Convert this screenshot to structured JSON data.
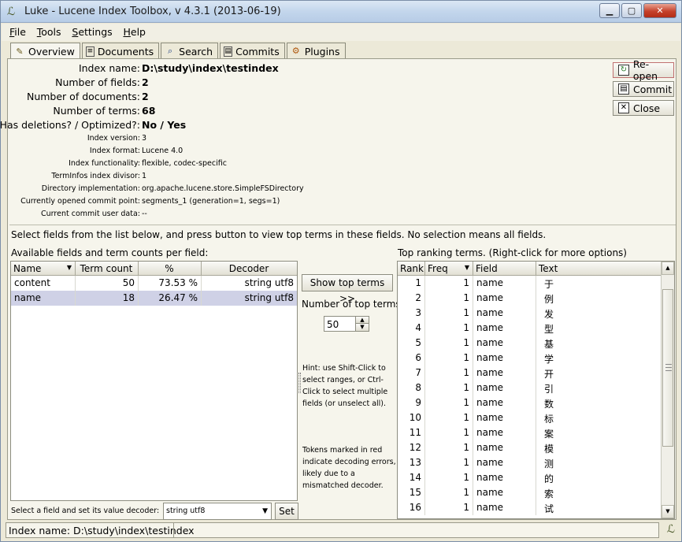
{
  "window": {
    "title": "Luke - Lucene Index Toolbox, v 4.3.1 (2013-06-19)",
    "icon": "luke-feather-icon"
  },
  "menu": [
    {
      "u": "F",
      "rest": "ile"
    },
    {
      "u": "T",
      "rest": "ools"
    },
    {
      "u": "S",
      "rest": "ettings"
    },
    {
      "u": "H",
      "rest": "elp"
    }
  ],
  "tabs": [
    {
      "label": "Overview",
      "icon": "overview-icon",
      "active": true
    },
    {
      "label": "Documents",
      "icon": "documents-icon",
      "active": false
    },
    {
      "label": "Search",
      "icon": "search-icon",
      "active": false
    },
    {
      "label": "Commits",
      "icon": "commits-icon",
      "active": false
    },
    {
      "label": "Plugins",
      "icon": "plugins-icon",
      "active": false
    }
  ],
  "overview": {
    "index_name_label": "Index name:",
    "index_name": "D:\\study\\index\\testindex",
    "num_fields_label": "Number of fields:",
    "num_fields": "2",
    "num_docs_label": "Number of documents:",
    "num_docs": "2",
    "num_terms_label": "Number of terms:",
    "num_terms": "68",
    "deletions_label": "Has deletions? / Optimized?:",
    "deletions": "No / Yes",
    "index_version_label": "Index version:",
    "index_version": "3",
    "index_format_label": "Index format:",
    "index_format": "Lucene 4.0",
    "functionality_label": "Index functionality:",
    "functionality": "flexible, codec-specific",
    "divisor_label": "TermInfos index divisor:",
    "divisor": "1",
    "dir_impl_label": "Directory implementation:",
    "dir_impl": "org.apache.lucene.store.SimpleFSDirectory",
    "commit_point_label": "Currently opened commit point:",
    "commit_point": "segments_1 (generation=1, segs=1)",
    "user_data_label": "Current commit user data:",
    "user_data": "--"
  },
  "buttons": {
    "reopen": "Re-open",
    "commit": "Commit",
    "close": "Close"
  },
  "instructions": "Select fields from the list below, and press button to view top terms in these fields. No selection means all fields.",
  "fields_table": {
    "label": "Available fields and term counts per field:",
    "headers": [
      "Name",
      "Term count",
      "%",
      "Decoder"
    ],
    "rows": [
      {
        "name": "content",
        "count": "50",
        "pct": "73.53 %",
        "decoder": "string utf8",
        "selected": false
      },
      {
        "name": "name",
        "count": "18",
        "pct": "26.47 %",
        "decoder": "string utf8",
        "selected": true
      }
    ]
  },
  "decoder": {
    "label": "Select a field and set its value decoder:",
    "value": "string utf8",
    "set_label": "Set"
  },
  "middle": {
    "show_top_label": "Show top terms >>",
    "num_top_label": "Number of top terms:",
    "num_top_value": "50",
    "hint": "Hint: use Shift-Click to select ranges, or Ctrl-Click to select multiple fields (or unselect all).",
    "tokens_note": "Tokens marked in red indicate decoding errors, likely due to a mismatched decoder."
  },
  "terms_table": {
    "label": "Top ranking terms. (Right-click for more options)",
    "headers": [
      "Rank",
      "Freq",
      "Field",
      "Text"
    ],
    "rows": [
      {
        "rank": "1",
        "freq": "1",
        "field": "name",
        "text": "于"
      },
      {
        "rank": "2",
        "freq": "1",
        "field": "name",
        "text": "例"
      },
      {
        "rank": "3",
        "freq": "1",
        "field": "name",
        "text": "发"
      },
      {
        "rank": "4",
        "freq": "1",
        "field": "name",
        "text": "型"
      },
      {
        "rank": "5",
        "freq": "1",
        "field": "name",
        "text": "基"
      },
      {
        "rank": "6",
        "freq": "1",
        "field": "name",
        "text": "学"
      },
      {
        "rank": "7",
        "freq": "1",
        "field": "name",
        "text": "开"
      },
      {
        "rank": "8",
        "freq": "1",
        "field": "name",
        "text": "引"
      },
      {
        "rank": "9",
        "freq": "1",
        "field": "name",
        "text": "数"
      },
      {
        "rank": "10",
        "freq": "1",
        "field": "name",
        "text": "标"
      },
      {
        "rank": "11",
        "freq": "1",
        "field": "name",
        "text": "案"
      },
      {
        "rank": "12",
        "freq": "1",
        "field": "name",
        "text": "模"
      },
      {
        "rank": "13",
        "freq": "1",
        "field": "name",
        "text": "测"
      },
      {
        "rank": "14",
        "freq": "1",
        "field": "name",
        "text": "的"
      },
      {
        "rank": "15",
        "freq": "1",
        "field": "name",
        "text": "索"
      },
      {
        "rank": "16",
        "freq": "1",
        "field": "name",
        "text": "试"
      }
    ]
  },
  "status": {
    "label": "Index name:",
    "value": "D:\\study\\index\\testindex"
  }
}
